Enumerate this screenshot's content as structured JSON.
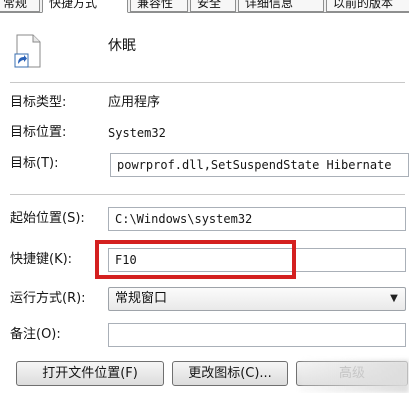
{
  "tabs": [
    {
      "label": "常规",
      "active": false
    },
    {
      "label": "快捷方式",
      "active": true
    },
    {
      "label": "兼容性",
      "active": false
    },
    {
      "label": "安全",
      "active": false
    },
    {
      "label": "详细信息",
      "active": false
    },
    {
      "label": "以前的版本",
      "active": false
    }
  ],
  "shortcut": {
    "icon": "shortcut-file-icon",
    "name": "休眠"
  },
  "fields": {
    "target_type_label": "目标类型:",
    "target_type_value": "应用程序",
    "target_location_label": "目标位置:",
    "target_location_value": "System32",
    "target_label": "目标(T):",
    "target_value": "powrprof.dll,SetSuspendState Hibernate",
    "start_in_label": "起始位置(S):",
    "start_in_value": "C:\\Windows\\system32",
    "hotkey_label": "快捷键(K):",
    "hotkey_value": "F10",
    "run_label": "运行方式(R):",
    "run_value": "常规窗口",
    "comment_label": "备注(O):",
    "comment_value": ""
  },
  "buttons": {
    "open_location": "打开文件位置(F)",
    "change_icon": "更改图标(C)...",
    "advanced": "高级"
  },
  "colors": {
    "highlight": "#d42020"
  }
}
